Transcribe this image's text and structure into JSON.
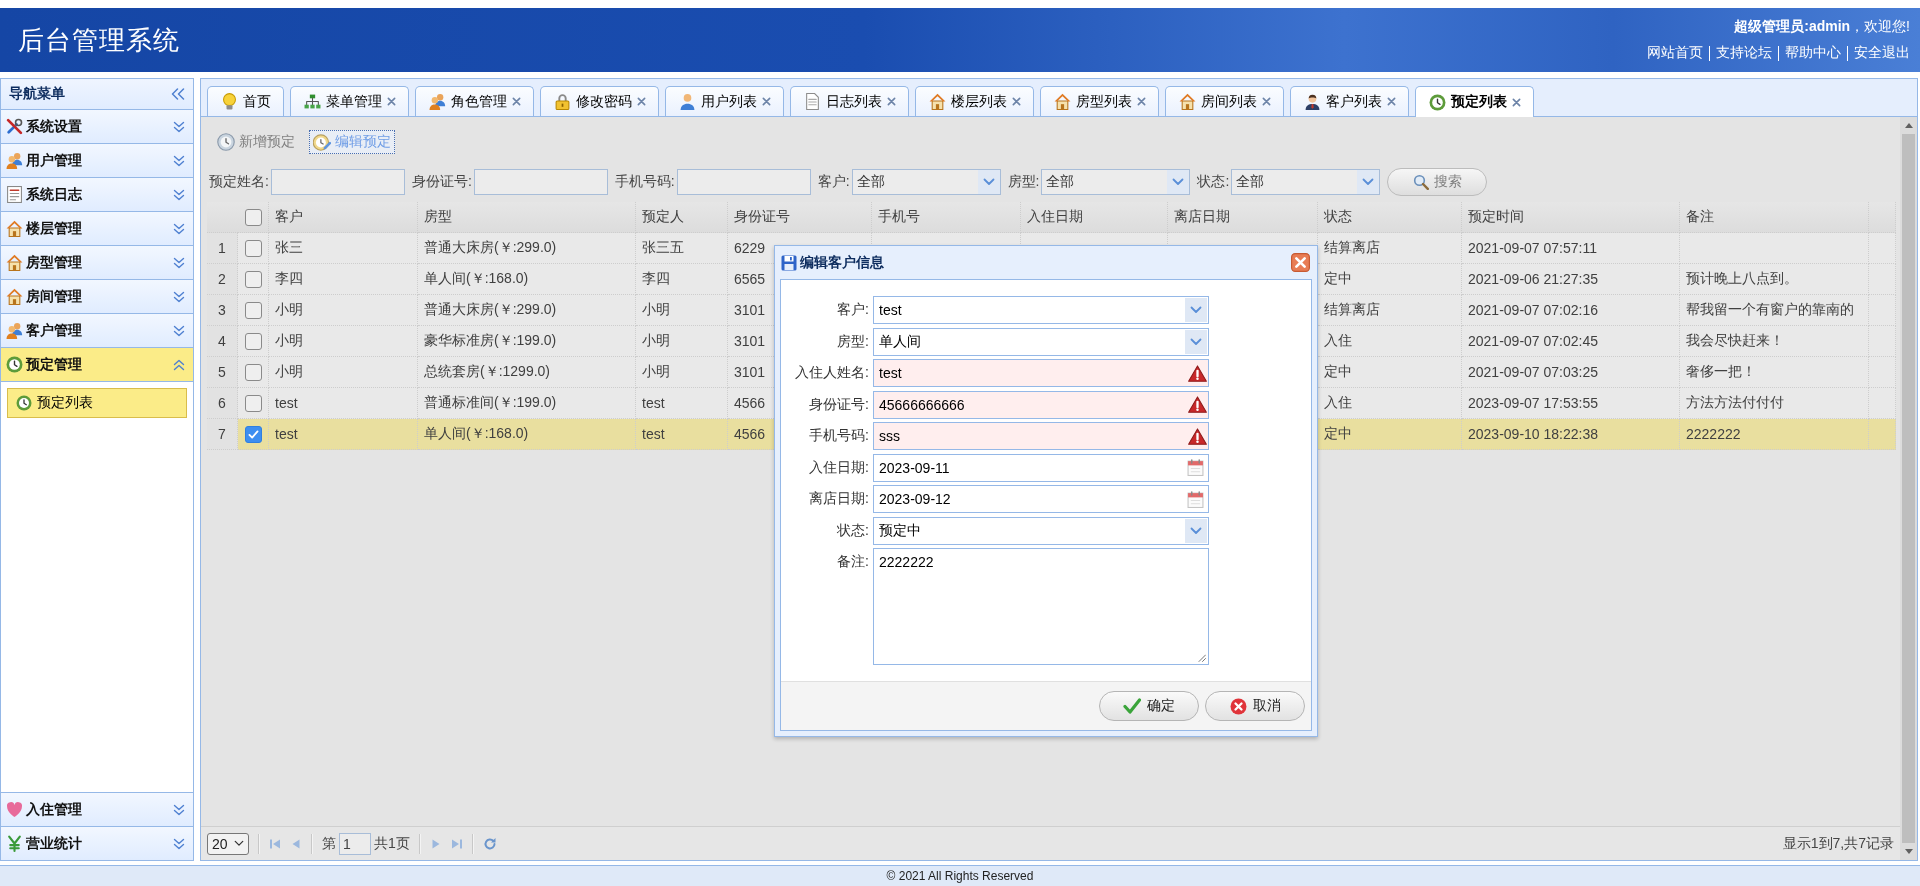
{
  "header": {
    "title": "后台管理系统",
    "greeting": "**超级管理员:admin**，欢迎您!",
    "links": [
      "网站首页",
      "支持论坛",
      "帮助中心",
      "安全退出"
    ]
  },
  "sidebar": {
    "title": "导航菜单",
    "items": [
      {
        "label": "系统设置",
        "expanded": false
      },
      {
        "label": "用户管理",
        "expanded": false
      },
      {
        "label": "系统日志",
        "expanded": false
      },
      {
        "label": "楼层管理",
        "expanded": false
      },
      {
        "label": "房型管理",
        "expanded": false
      },
      {
        "label": "房间管理",
        "expanded": false
      },
      {
        "label": "客户管理",
        "expanded": false
      },
      {
        "label": "预定管理",
        "expanded": true,
        "children": [
          {
            "label": "预定列表",
            "selected": true
          }
        ]
      },
      {
        "label": "入住管理",
        "expanded": false
      },
      {
        "label": "营业统计",
        "expanded": false
      }
    ]
  },
  "tabs": [
    {
      "label": "首页",
      "closable": false,
      "selected": false
    },
    {
      "label": "菜单管理",
      "closable": true,
      "selected": false
    },
    {
      "label": "角色管理",
      "closable": true,
      "selected": false
    },
    {
      "label": "修改密码",
      "closable": true,
      "selected": false
    },
    {
      "label": "用户列表",
      "closable": true,
      "selected": false
    },
    {
      "label": "日志列表",
      "closable": true,
      "selected": false
    },
    {
      "label": "楼层列表",
      "closable": true,
      "selected": false
    },
    {
      "label": "房型列表",
      "closable": true,
      "selected": false
    },
    {
      "label": "房间列表",
      "closable": true,
      "selected": false
    },
    {
      "label": "客户列表",
      "closable": true,
      "selected": false
    },
    {
      "label": "预定列表",
      "closable": true,
      "selected": true
    }
  ],
  "toolbar": [
    {
      "label": "新增预定",
      "active": false
    },
    {
      "label": "编辑预定",
      "active": true
    }
  ],
  "filters": {
    "fields": [
      {
        "label": "预定姓名:",
        "kind": "text"
      },
      {
        "label": "身份证号:",
        "kind": "text"
      },
      {
        "label": "手机号码:",
        "kind": "text"
      },
      {
        "label": "客户:",
        "kind": "select",
        "value": "全部"
      },
      {
        "label": "房型:",
        "kind": "select",
        "value": "全部"
      },
      {
        "label": "状态:",
        "kind": "select",
        "value": "全部"
      }
    ],
    "search_button": "搜索"
  },
  "table": {
    "all_checked": false,
    "columns": [
      "客户",
      "房型",
      "预定人",
      "身份证号",
      "手机号",
      "入住日期",
      "离店日期",
      "状态",
      "预定时间",
      "备注"
    ],
    "rows": [
      {
        "number": "1",
        "checked": false,
        "selected": false,
        "customer": "张三",
        "room_type": "普通大床房(￥:299.0)",
        "booker": "张三五",
        "id_number": "6229",
        "status": "结算离店",
        "booked_at": "2021-09-07 07:57:11"
      },
      {
        "number": "2",
        "checked": false,
        "selected": false,
        "customer": "李四",
        "room_type": "单人间(￥:168.0)",
        "booker": "李四",
        "id_number": "6565",
        "status": "定中",
        "booked_at": "2021-09-06 21:27:35",
        "note": "预计晚上八点到。"
      },
      {
        "number": "3",
        "checked": false,
        "selected": false,
        "customer": "小明",
        "room_type": "普通大床房(￥:299.0)",
        "booker": "小明",
        "id_number": "3101",
        "status": "结算离店",
        "booked_at": "2021-09-07 07:02:16",
        "note": "帮我留一个有窗户的靠南的"
      },
      {
        "number": "4",
        "checked": false,
        "selected": false,
        "customer": "小明",
        "room_type": "豪华标准房(￥:199.0)",
        "booker": "小明",
        "id_number": "3101",
        "status": "入住",
        "booked_at": "2021-09-07 07:02:45",
        "note": "我会尽快赶来！"
      },
      {
        "number": "5",
        "checked": false,
        "selected": false,
        "customer": "小明",
        "room_type": "总统套房(￥:1299.0)",
        "booker": "小明",
        "id_number": "3101",
        "status": "定中",
        "booked_at": "2021-09-07 07:03:25",
        "note": "奢侈一把！"
      },
      {
        "number": "6",
        "checked": false,
        "selected": false,
        "customer": "test",
        "room_type": "普通标准间(￥:199.0)",
        "booker": "test",
        "id_number": "4566",
        "status": "入住",
        "booked_at": "2023-09-07 17:53:55",
        "note": "方法方法付付付"
      },
      {
        "number": "7",
        "checked": true,
        "selected": true,
        "customer": "test",
        "room_type": "单人间(￥:168.0)",
        "booker": "test",
        "id_number": "4566",
        "status": "定中",
        "booked_at": "2023-09-10 18:22:38",
        "note": "2222222"
      }
    ]
  },
  "pagination": {
    "page_size": "20",
    "page_prefix": "第",
    "page": "1",
    "page_total": "共1页",
    "summary": "显示1到7,共7记录"
  },
  "dialog": {
    "title": "编辑客户信息",
    "fields": [
      {
        "label": "客户:",
        "kind": "select",
        "value": "test",
        "invalid": false
      },
      {
        "label": "房型:",
        "kind": "select",
        "value": "单人间",
        "invalid": false
      },
      {
        "label": "入住人姓名:",
        "kind": "text",
        "value": "test",
        "invalid": true
      },
      {
        "label": "身份证号:",
        "kind": "text",
        "value": "45666666666",
        "invalid": true
      },
      {
        "label": "手机号码:",
        "kind": "text",
        "value": "sss",
        "invalid": true
      },
      {
        "label": "入住日期:",
        "kind": "date",
        "value": "2023-09-11",
        "invalid": false
      },
      {
        "label": "离店日期:",
        "kind": "date",
        "value": "2023-09-12",
        "invalid": false
      },
      {
        "label": "状态:",
        "kind": "select",
        "value": "预定中",
        "invalid": false
      },
      {
        "label": "备注:",
        "kind": "textarea",
        "value": "2222222",
        "invalid": false
      }
    ],
    "buttons": [
      {
        "label": "确定",
        "kind": "ok"
      },
      {
        "label": "取消",
        "kind": "cancel"
      }
    ]
  },
  "footer": "© 2021 All Rights Reserved"
}
